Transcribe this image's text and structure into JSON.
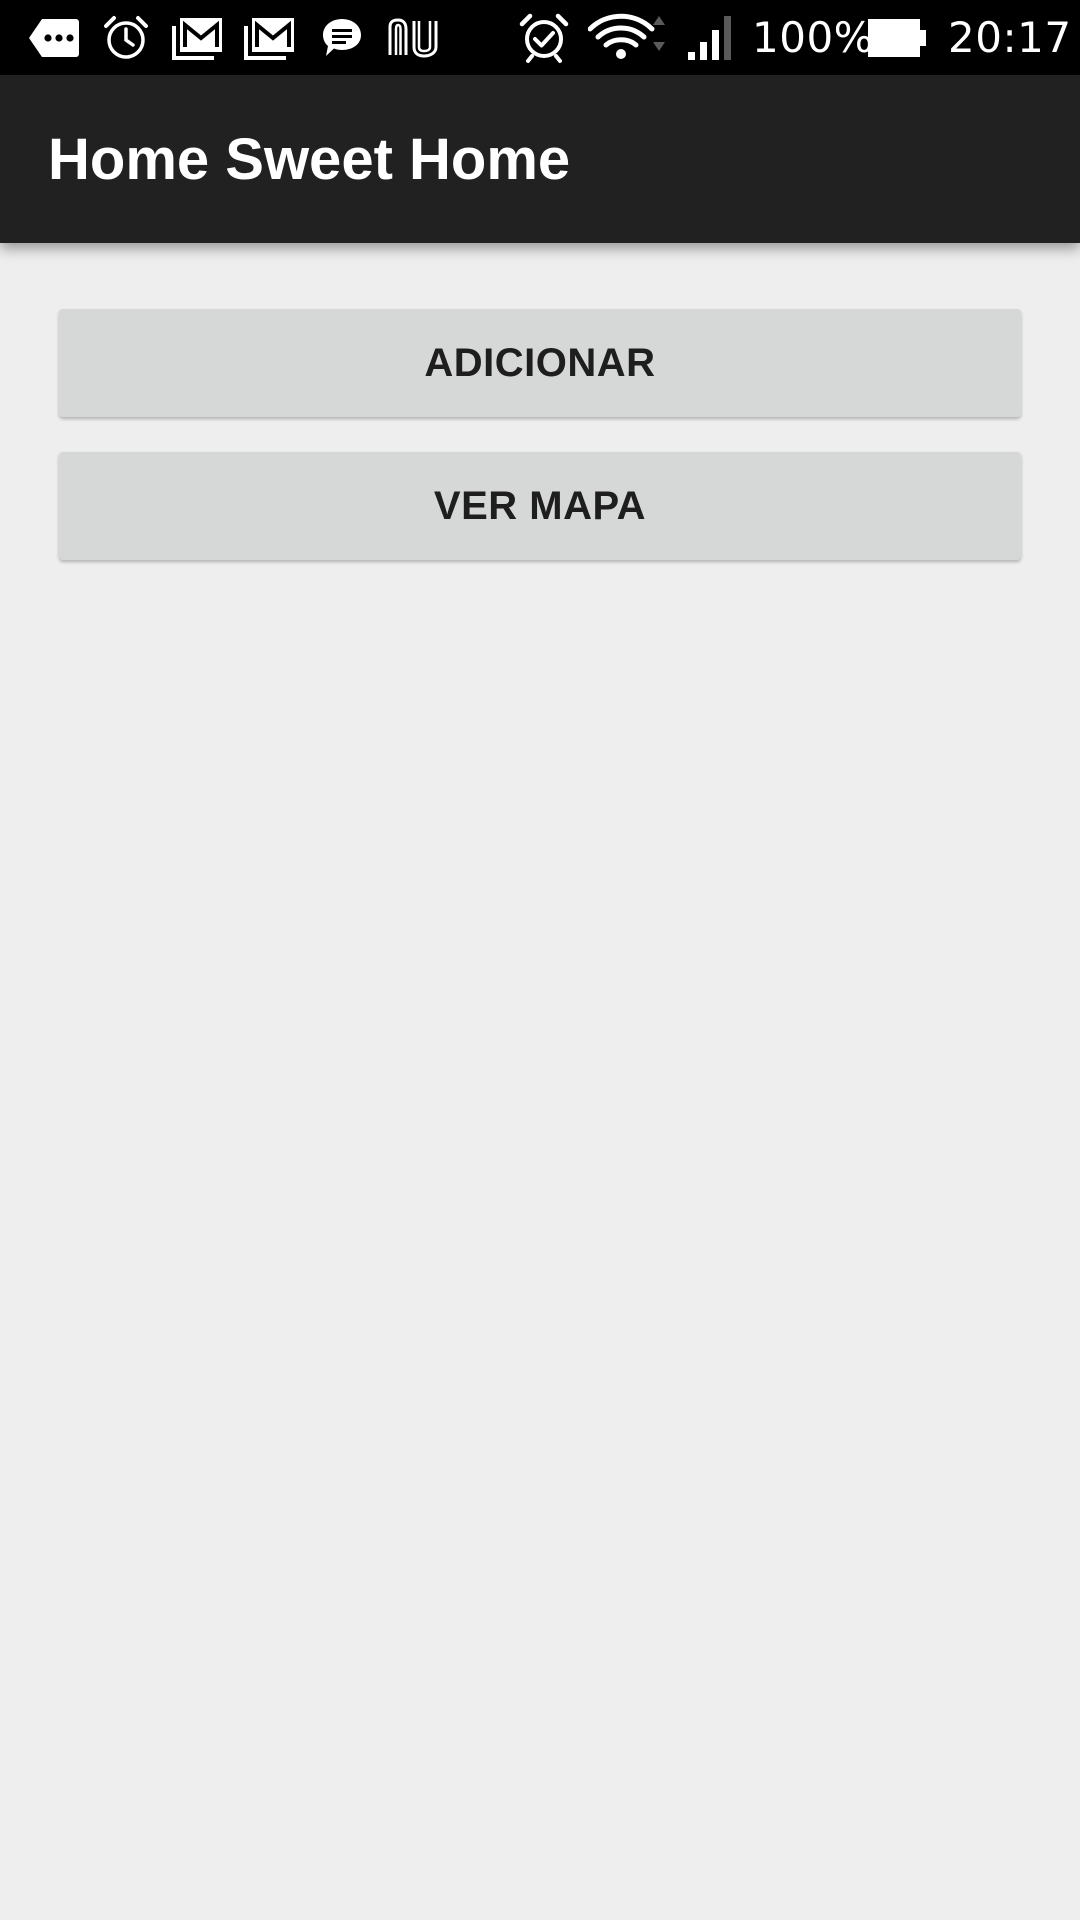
{
  "status_bar": {
    "notification_icons": [
      "more-messages-icon",
      "alarm-clock-icon",
      "gmail-icon",
      "gmail-icon",
      "chat-icon",
      "nubank-icon"
    ],
    "system_icons": [
      "alarm-set-icon",
      "wifi-icon",
      "signal-icon",
      "battery-icon"
    ],
    "battery_percent": "100%",
    "time": "20:17"
  },
  "app_bar": {
    "title": "Home Sweet Home"
  },
  "main": {
    "add_button_label": "ADICIONAR",
    "map_button_label": "VER MAPA"
  },
  "colors": {
    "status_bar": "#000000",
    "app_bar": "#212121",
    "background": "#eeeeee",
    "button": "#d6d7d7",
    "button_text": "#1e1e1e"
  }
}
